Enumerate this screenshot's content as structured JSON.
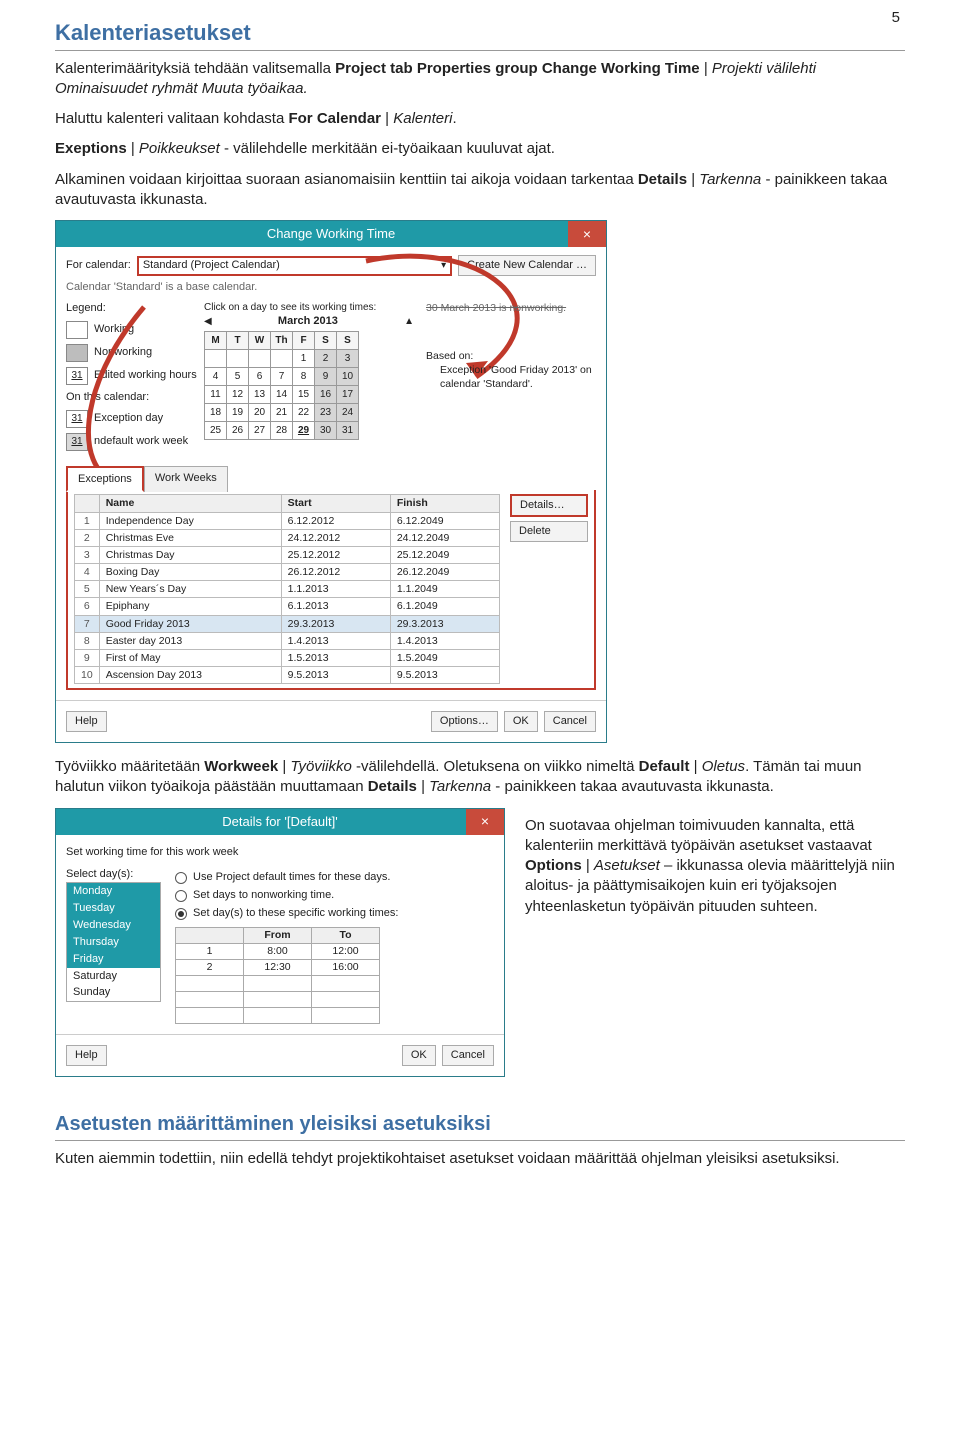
{
  "page_number": "5",
  "h_main": "Kalenteriasetukset",
  "p1": {
    "a": "Kalenterimäärityksiä tehdään valitsemalla ",
    "b": "Project tab Properties group Change Working Time",
    "c": " | ",
    "d": "Projekti välilehti Ominaisuudet ryhmät Muuta työaikaa."
  },
  "p2": {
    "a": "Haluttu kalenteri valitaan kohdasta ",
    "b": "For Calendar",
    "c": " | ",
    "d": "Kalenteri"
  },
  "p3": {
    "a": "Exeptions",
    "b": " | ",
    "c": "Poikkeukset",
    "d": " - välilehdelle merkitään ei-työaikaan kuuluvat ajat."
  },
  "p4": {
    "a": "Alkaminen voidaan kirjoittaa suoraan asianomaisiin kenttiin tai aikoja voidaan tarkentaa ",
    "b": "Details",
    "c": " | ",
    "d": "Tarkenna",
    "e": " - painikkeen takaa avautuvasta ikkunasta."
  },
  "dlg1": {
    "title": "Change Working Time",
    "close": "×",
    "for_calendar_label": "For calendar:",
    "for_calendar_value": "Standard (Project Calendar)",
    "create_new": "Create New Calendar …",
    "basecal": "Calendar 'Standard' is a base calendar.",
    "legend_label": "Legend:",
    "clicknote": "Click on a day to see its working times:",
    "strike": "30 March 2013 is nonworking.",
    "month": "March 2013",
    "dow": [
      "M",
      "T",
      "W",
      "Th",
      "F",
      "S",
      "S"
    ],
    "weeks": [
      [
        "",
        "",
        "",
        "",
        "1",
        "2",
        "3"
      ],
      [
        "4",
        "5",
        "6",
        "7",
        "8",
        "9",
        "10"
      ],
      [
        "11",
        "12",
        "13",
        "14",
        "15",
        "16",
        "17"
      ],
      [
        "18",
        "19",
        "20",
        "21",
        "22",
        "23",
        "24"
      ],
      [
        "25",
        "26",
        "27",
        "28",
        "29",
        "30",
        "31"
      ]
    ],
    "hl_day": "29",
    "legend": {
      "working": "Working",
      "nonworking": "Nonworking",
      "edited": "Edited working hours",
      "onthis": "On this calendar:",
      "excday": "Exception day",
      "ndef": "ndefault work week",
      "d31": "31"
    },
    "based_label": "Based on:",
    "based_text": "Exception 'Good Friday 2013' on calendar 'Standard'.",
    "tabs": {
      "exceptions": "Exceptions",
      "workweeks": "Work Weeks"
    },
    "cols": {
      "name": "Name",
      "start": "Start",
      "finish": "Finish"
    },
    "rows": [
      {
        "n": "1",
        "name": "Independence Day",
        "start": "6.12.2012",
        "finish": "6.12.2049"
      },
      {
        "n": "2",
        "name": "Christmas Eve",
        "start": "24.12.2012",
        "finish": "24.12.2049"
      },
      {
        "n": "3",
        "name": "Christmas Day",
        "start": "25.12.2012",
        "finish": "25.12.2049"
      },
      {
        "n": "4",
        "name": "Boxing Day",
        "start": "26.12.2012",
        "finish": "26.12.2049"
      },
      {
        "n": "5",
        "name": "New Years´s Day",
        "start": "1.1.2013",
        "finish": "1.1.2049"
      },
      {
        "n": "6",
        "name": "Epiphany",
        "start": "6.1.2013",
        "finish": "6.1.2049"
      },
      {
        "n": "7",
        "name": "Good Friday 2013",
        "start": "29.3.2013",
        "finish": "29.3.2013"
      },
      {
        "n": "8",
        "name": "Easter day 2013",
        "start": "1.4.2013",
        "finish": "1.4.2013"
      },
      {
        "n": "9",
        "name": "First of May",
        "start": "1.5.2013",
        "finish": "1.5.2049"
      },
      {
        "n": "10",
        "name": "Ascension Day 2013",
        "start": "9.5.2013",
        "finish": "9.5.2013"
      }
    ],
    "details_btn": "Details…",
    "delete_btn": "Delete",
    "help": "Help",
    "options": "Options…",
    "ok": "OK",
    "cancel": "Cancel"
  },
  "p5": {
    "a": "Työviikko määritetään ",
    "b": "Workweek",
    "c": " | ",
    "d": "Työviikko",
    "e": " -välilehdellä. Oletuksena on viikko nimeltä ",
    "f": "Default",
    "g": " | ",
    "h": "Oletus",
    "i": ". Tämän tai muun halutun viikon työaikoja päästään muuttamaan ",
    "j": "Details",
    "k": " | ",
    "l": "Tarkenna",
    "m": " - painikkeen takaa avautuvasta ikkunasta."
  },
  "dlg2": {
    "title": "Details for '[Default]'",
    "close": "×",
    "heading": "Set working time for this work week",
    "select_days": "Select day(s):",
    "days": [
      "Monday",
      "Tuesday",
      "Wednesday",
      "Thursday",
      "Friday",
      "Saturday",
      "Sunday"
    ],
    "r1": "Use Project default times for these days.",
    "r2": "Set days to nonworking time.",
    "r3": "Set day(s) to these specific working times:",
    "from": "From",
    "to": "To",
    "slots": [
      {
        "n": "1",
        "from": "8:00",
        "to": "12:00"
      },
      {
        "n": "2",
        "from": "12:30",
        "to": "16:00"
      }
    ],
    "help": "Help",
    "ok": "OK",
    "cancel": "Cancel"
  },
  "side_p": {
    "a": "On suotavaa ohjelman toimivuuden kannalta, että kalenteriin merkittävä työpäivän asetukset vastaavat ",
    "b": "Options",
    "c": " | ",
    "d": "Asetukset",
    "e": " – ikkunassa olevia määrittelyjä niin aloitus- ja päättymisaikojen kuin eri työjaksojen yhteenlasketun työpäivän pituuden suhteen."
  },
  "h_sub": "Asetusten määrittäminen yleisiksi asetuksiksi",
  "p_sub": "Kuten aiemmin todettiin, niin edellä tehdyt projektikohtaiset asetukset voidaan määrittää ohjelman yleisiksi asetuksiksi."
}
